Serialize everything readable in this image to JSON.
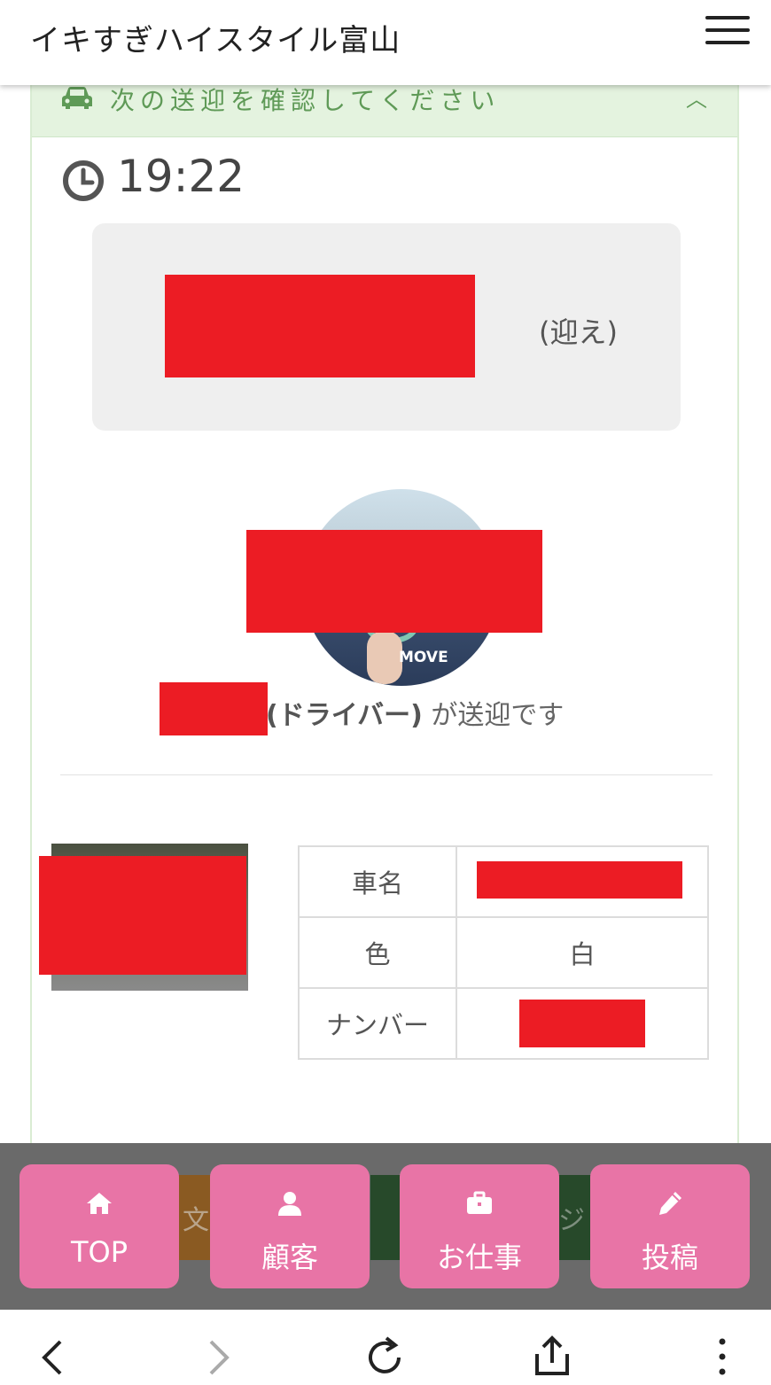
{
  "header": {
    "title": "イキすぎハイスタイル富山"
  },
  "card": {
    "head_text": "次の送迎を確認してください",
    "time": "19:22",
    "destination_suffix": "(迎え)",
    "driver_role": "(ドライバー)",
    "driver_suffix": "が送迎です",
    "avatar_badge": "MOVE"
  },
  "spec_table": {
    "rows": [
      {
        "label": "車名",
        "value": ""
      },
      {
        "label": "色",
        "value": "白"
      },
      {
        "label": "ナンバー",
        "value": ""
      }
    ]
  },
  "behind_text": {
    "left": "文",
    "right": "ジ"
  },
  "bottom_nav": [
    {
      "label": "TOP",
      "icon": "home-icon"
    },
    {
      "label": "顧客",
      "icon": "user-icon"
    },
    {
      "label": "お仕事",
      "icon": "briefcase-icon"
    },
    {
      "label": "投稿",
      "icon": "pencil-icon"
    }
  ],
  "browser_bar": {
    "icons": [
      "back-icon",
      "forward-icon",
      "reload-icon",
      "share-icon",
      "more-icon"
    ]
  },
  "colors": {
    "accent_pink": "#e874a6",
    "head_green": "#5f9a57",
    "redaction": "#ec1c24"
  }
}
